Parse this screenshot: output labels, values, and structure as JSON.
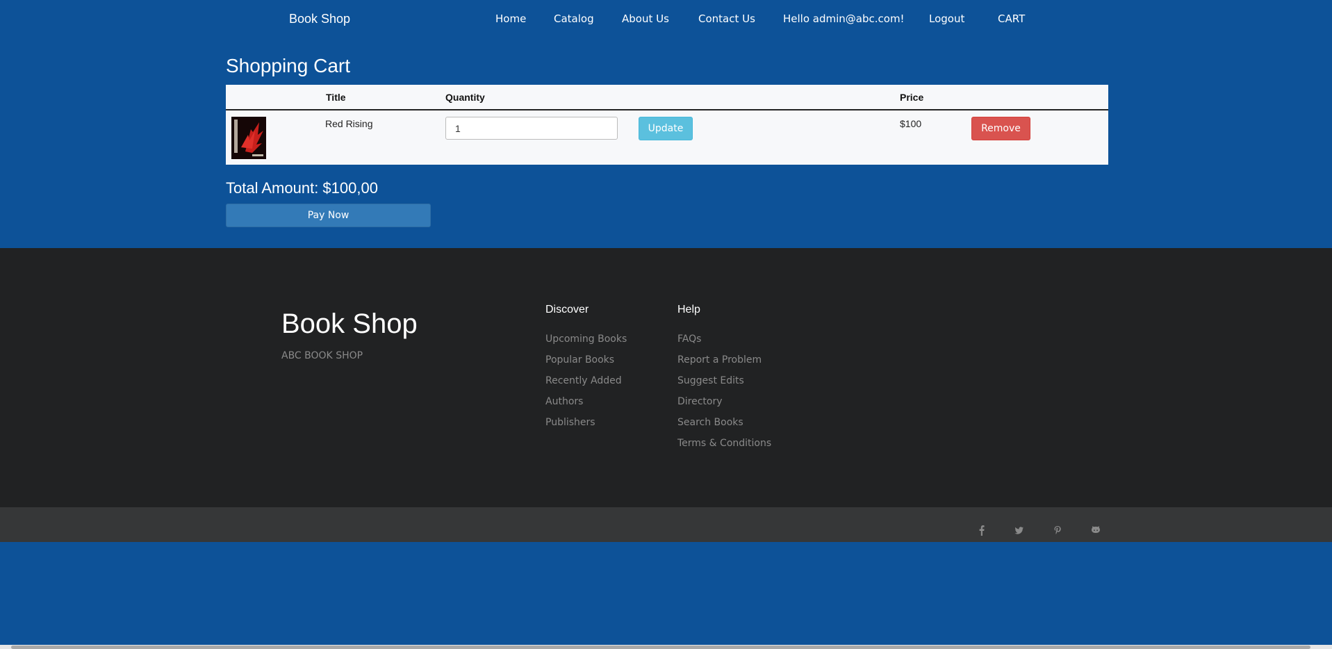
{
  "navbar": {
    "brand": "Book Shop",
    "items": [
      "Home",
      "Catalog",
      "About Us",
      "Contact Us",
      "Hello admin@abc.com!",
      "Logout",
      "CART"
    ]
  },
  "cart": {
    "title": "Shopping Cart",
    "headers": {
      "image": "",
      "title": "Title",
      "quantity": "Quantity",
      "price": "Price"
    },
    "rows": [
      {
        "book_title": "Red Rising",
        "quantity": "1",
        "price": "$100",
        "update_label": "Update",
        "remove_label": "Remove"
      }
    ],
    "total": "Total Amount: $100,00",
    "pay_label": "Pay Now"
  },
  "footer": {
    "brand": "Book Shop",
    "tagline": "ABC BOOK SHOP",
    "discover": {
      "heading": "Discover",
      "links": [
        "Upcoming Books",
        "Popular Books",
        "Recently Added",
        "Authors",
        "Publishers"
      ]
    },
    "help": {
      "heading": "Help",
      "links": [
        "FAQs",
        "Report a Problem",
        "Suggest Edits",
        "Directory",
        "Search Books",
        "Terms & Conditions"
      ]
    },
    "social": [
      "facebook-icon",
      "twitter-icon",
      "pinterest-icon",
      "github-icon"
    ]
  },
  "colors": {
    "page_bg": "#0d5298",
    "footer_bg": "#212223",
    "subfooter_bg": "#363738",
    "update_btn": "#5bc0de",
    "remove_btn": "#d9534f",
    "pay_btn": "#337ab7"
  }
}
